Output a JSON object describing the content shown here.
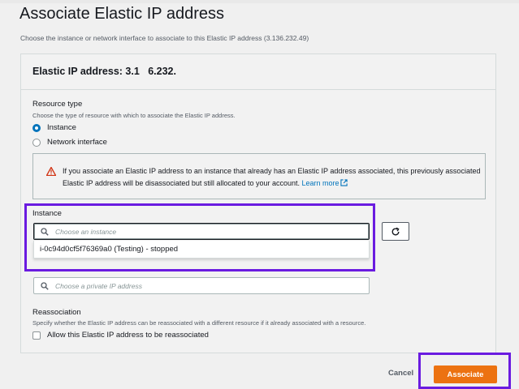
{
  "page": {
    "title": "Associate Elastic IP address",
    "subtitle": "Choose the instance or network interface to associate to this Elastic IP address (3.136.232.49)"
  },
  "panel": {
    "title": "Elastic IP address: 3.1   6.232. "
  },
  "resource_type": {
    "label": "Resource type",
    "description": "Choose the type of resource with which to associate the Elastic IP address.",
    "options": [
      {
        "label": "Instance",
        "selected": true
      },
      {
        "label": "Network interface",
        "selected": false
      }
    ]
  },
  "warning": {
    "icon": "warning-triangle-icon",
    "text": "If you associate an Elastic IP address to an instance that already has an Elastic IP address associated, this previously associated Elastic IP address will be disassociated but still allocated to your account.",
    "link_label": "Learn more",
    "link_icon": "external-link-icon"
  },
  "instance": {
    "label": "Instance",
    "placeholder": "Choose an instance",
    "dropdown_option": "i-0c94d0cf5f76369a0 (Testing) - stopped",
    "refresh_icon": "refresh-icon"
  },
  "private_ip": {
    "placeholder": "Choose a private IP address"
  },
  "reassociation": {
    "label": "Reassociation",
    "description": "Specify whether the Elastic IP address can be reassociated with a different resource if it already associated with a resource.",
    "checkbox_label": "Allow this Elastic IP address to be reassociated",
    "checked": false
  },
  "footer": {
    "cancel_label": "Cancel",
    "associate_label": "Associate"
  },
  "colors": {
    "primary_button": "#ec7211",
    "link": "#0073bb",
    "highlight": "#6a1be0",
    "warning": "#d13212"
  }
}
